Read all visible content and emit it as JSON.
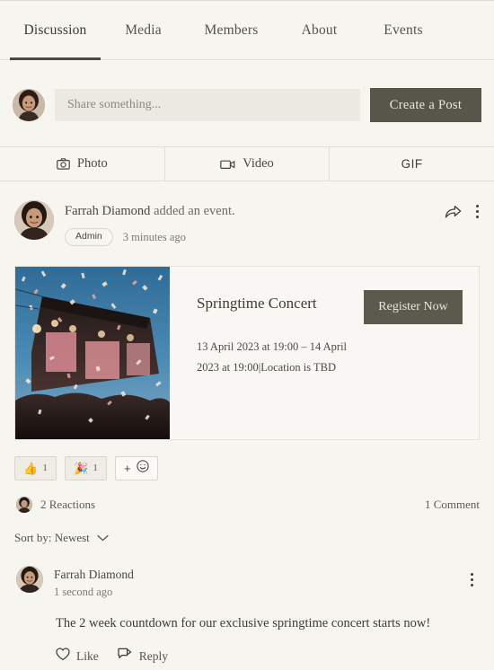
{
  "tabs": [
    {
      "label": "Discussion",
      "active": true
    },
    {
      "label": "Media",
      "active": false
    },
    {
      "label": "Members",
      "active": false
    },
    {
      "label": "About",
      "active": false
    },
    {
      "label": "Events",
      "active": false
    }
  ],
  "composer": {
    "placeholder": "Share something...",
    "value": "",
    "create_post_label": "Create a Post",
    "avatar_alt": "Farrah Diamond"
  },
  "media_bar": [
    {
      "label": "Photo",
      "icon": "camera-icon"
    },
    {
      "label": "Video",
      "icon": "video-camera-icon"
    },
    {
      "label": "GIF",
      "icon": "gif-text"
    }
  ],
  "post": {
    "author": "Farrah Diamond",
    "action_text": " added an event.",
    "badge": "Admin",
    "timestamp": "3 minutes ago",
    "share_icon": "share-arrow-icon",
    "menu_icon": "more-options-icon",
    "event": {
      "title": "Springtime Concert",
      "details": "13 April 2023 at 19:00 – 14 April 2023 at 19:00|Location is TBD",
      "cta_label": "Register Now",
      "image_alt": "concert-stage-confetti-crowd"
    },
    "reactions": [
      {
        "emoji": "👍",
        "name": "thumbs-up",
        "count": "1"
      },
      {
        "emoji": "🎉",
        "name": "party-popper",
        "count": "1"
      }
    ],
    "add_reaction_label": "+",
    "reactions_summary": "2 Reactions",
    "comments_summary": "1 Comment",
    "sort_label": "Sort by: Newest"
  },
  "comment": {
    "author": "Farrah Diamond",
    "timestamp": "1 second ago",
    "text": "The 2 week countdown for our exclusive springtime concert starts now!",
    "like_label": "Like",
    "reply_label": "Reply",
    "menu_icon": "more-options-icon"
  },
  "colors": {
    "page_background": "#f7f5f0",
    "accent_dark": "#58564a",
    "text_primary": "#3f3c36",
    "text_muted": "#7d7970",
    "divider": "#e3dfd4"
  }
}
